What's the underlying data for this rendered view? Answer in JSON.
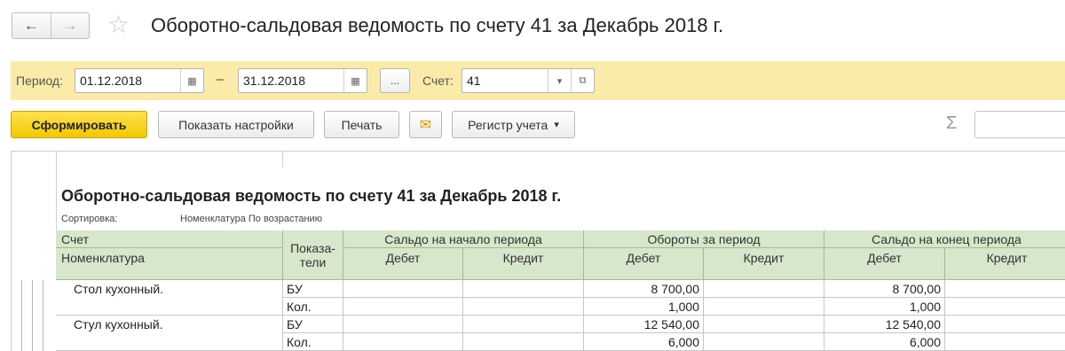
{
  "header": {
    "title": "Оборотно-сальдовая ведомость по счету 41 за Декабрь 2018 г.",
    "back_icon": "←",
    "forward_icon": "→",
    "star_icon": "☆"
  },
  "filter": {
    "period_label": "Период:",
    "date_from": "01.12.2018",
    "dash": "–",
    "date_to": "31.12.2018",
    "ellipsis": "...",
    "account_label": "Счет:",
    "account_value": "41",
    "calendar_icon": "▦",
    "dropdown_icon": "▾",
    "open_icon": "⧉"
  },
  "toolbar": {
    "generate": "Сформировать",
    "show_settings": "Показать настройки",
    "print": "Печать",
    "mail_icon": "✉",
    "register": "Регистр учета",
    "register_arrow": "▾",
    "sigma": "Σ"
  },
  "report": {
    "title": "Оборотно-сальдовая ведомость по счету 41 за Декабрь 2018 г.",
    "sort_label": "Сортировка:",
    "sort_value": "Номенклатура По возрастанию",
    "headers": {
      "account": "Счет",
      "nomenclature": "Номенклатура",
      "indicators_1": "Показа-",
      "indicators_2": "тели",
      "opening": "Сальдо на начало периода",
      "turnover": "Обороты за период",
      "closing": "Сальдо на конец периода",
      "debit": "Дебет",
      "credit": "Кредит"
    },
    "rows": [
      {
        "name": "Стол кухонный.",
        "lines": [
          {
            "ind": "БУ",
            "turn_debit": "8 700,00",
            "close_debit": "8 700,00"
          },
          {
            "ind": "Кол.",
            "turn_debit": "1,000",
            "close_debit": "1,000"
          }
        ]
      },
      {
        "name": "Стул кухонный.",
        "lines": [
          {
            "ind": "БУ",
            "turn_debit": "12 540,00",
            "close_debit": "12 540,00"
          },
          {
            "ind": "Кол.",
            "turn_debit": "6,000",
            "close_debit": "6,000"
          }
        ]
      }
    ]
  }
}
